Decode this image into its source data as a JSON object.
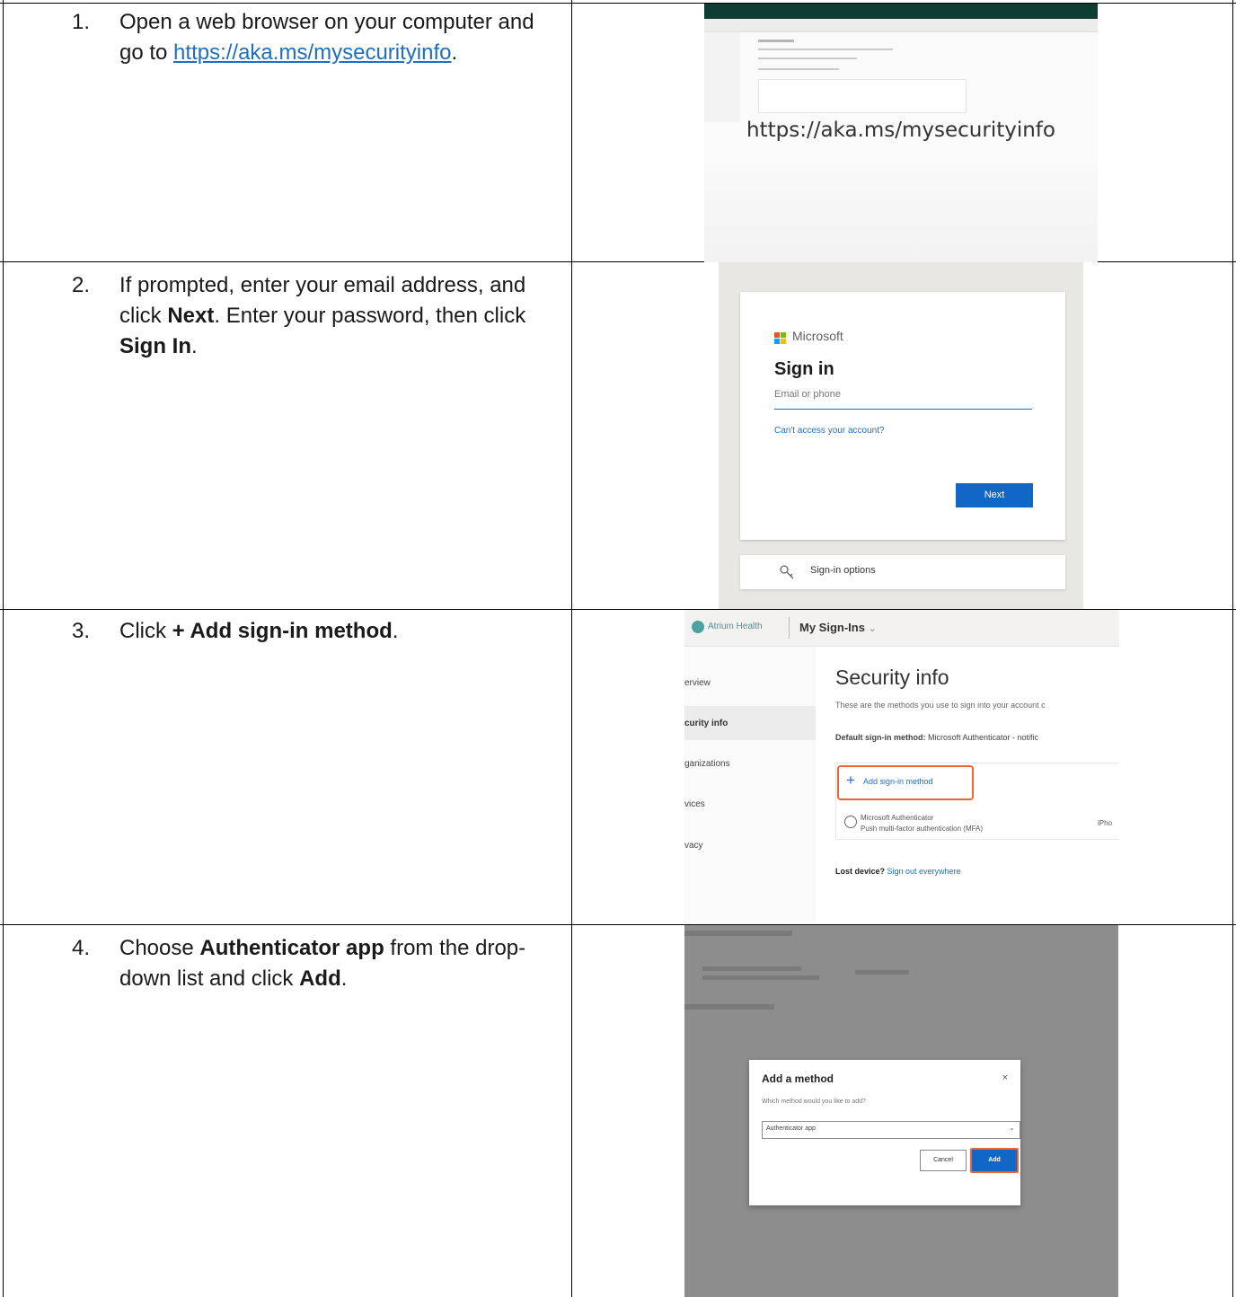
{
  "steps": [
    {
      "num": "1.",
      "text_a": "Open a web browser on your computer and go to ",
      "link": "https://aka.ms/mysecurityinfo",
      "text_b": "."
    },
    {
      "num": "2.",
      "text_a": "If prompted, enter your email address, and click ",
      "bold_a": "Next",
      "text_b": ". Enter your password, then click ",
      "bold_b": "Sign In",
      "text_c": "."
    },
    {
      "num": "3.",
      "text_a": "Click ",
      "bold_a": "+ Add sign-in method",
      "text_b": "."
    },
    {
      "num": "4.",
      "text_a": "Choose ",
      "bold_a": "Authenticator app",
      "text_b": " from the drop-down list and click ",
      "bold_b": "Add",
      "text_c": "."
    }
  ],
  "shot1": {
    "url_caption": "https://aka.ms/mysecurityinfo"
  },
  "shot2": {
    "brand": "Microsoft",
    "title": "Sign in",
    "email_placeholder": "Email or phone",
    "access_link": "Can't access your account?",
    "next_button": "Next",
    "signin_options": "Sign-in options",
    "logo_colors": [
      "#f25022",
      "#7fba00",
      "#00a4ef",
      "#ffb900"
    ]
  },
  "shot3": {
    "org": "Atrium Health",
    "app": "My Sign-Ins",
    "app_chevron": "⌄",
    "nav": [
      "erview",
      "curity info",
      "ganizations",
      "vices",
      "vacy"
    ],
    "heading": "Security info",
    "subtitle": "These are the methods you use to sign into your account c",
    "default_label": "Default sign-in method:",
    "default_value": " Microsoft Authenticator - notific",
    "add_button": "Add sign-in method",
    "method_name": "Microsoft Authenticator",
    "method_desc": "Push multi-factor authentication (MFA)",
    "method_device": "iPho",
    "lost_label": "Lost device?",
    "lost_link": " Sign out everywhere"
  },
  "shot4": {
    "dialog_title": "Add a method",
    "close": "×",
    "question": "Which method would you like to add?",
    "selected_option": "Authenticator app",
    "cancel_button": "Cancel",
    "add_button": "Add"
  }
}
